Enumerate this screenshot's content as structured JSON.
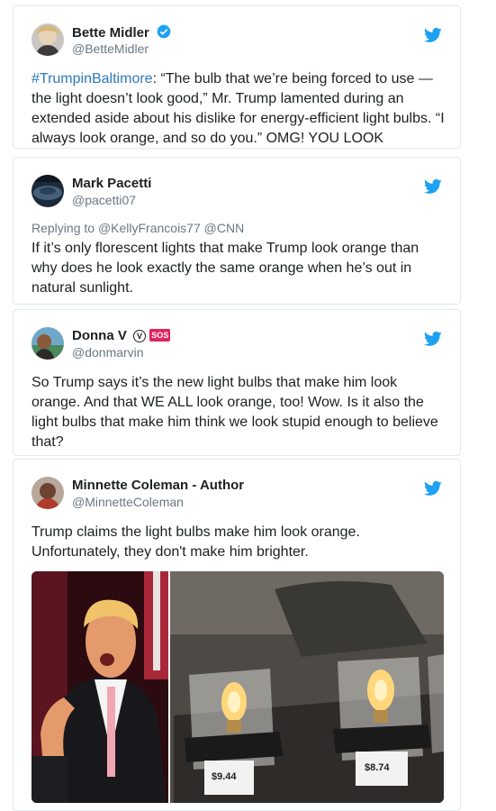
{
  "tweets": [
    {
      "name": "Bette Midler",
      "handle": "@BetteMidler",
      "verified": true,
      "hashtag": "#TrumpinBaltimore",
      "text": ": “The bulb that we’re being forced to use — the light doesn’t look good,” Mr. Trump lamented during an extended aside about his dislike for energy-efficient light bulbs. “I always look orange, and so do you.” OMG! YOU LOOK"
    },
    {
      "name": "Mark Pacetti",
      "handle": "@pacetti07",
      "reply_prefix": "Replying to ",
      "reply_to": "@KellyFrancois77 @CNN",
      "text": "If it’s only florescent lights that make Trump look orange than why does he look exactly the same orange when he’s out in natural sunlight."
    },
    {
      "name": "Donna V",
      "handle": "@donmarvin",
      "badge_v": "V",
      "badge_sos": "SOS",
      "text": "So Trump says it’s the new light bulbs that make him look orange. And that WE ALL look orange, too!  Wow. Is it also the light bulbs that make him think we look stupid enough to believe that?"
    },
    {
      "name": "Minnette Coleman - Author",
      "handle": "@MinnetteColeman",
      "text": "Trump claims the light bulbs make him look orange. Unfortunately, they don't make him brighter.",
      "price_left": "$9.44",
      "price_right": "$8.74"
    }
  ],
  "colors": {
    "link": "#2b7bb9",
    "twitter_blue": "#1da1f2",
    "secondary_text": "#697882",
    "border": "#e1e8ed"
  },
  "icons": [
    "twitter-bird-icon",
    "verified-badge-icon",
    "sos-badge-icon"
  ]
}
